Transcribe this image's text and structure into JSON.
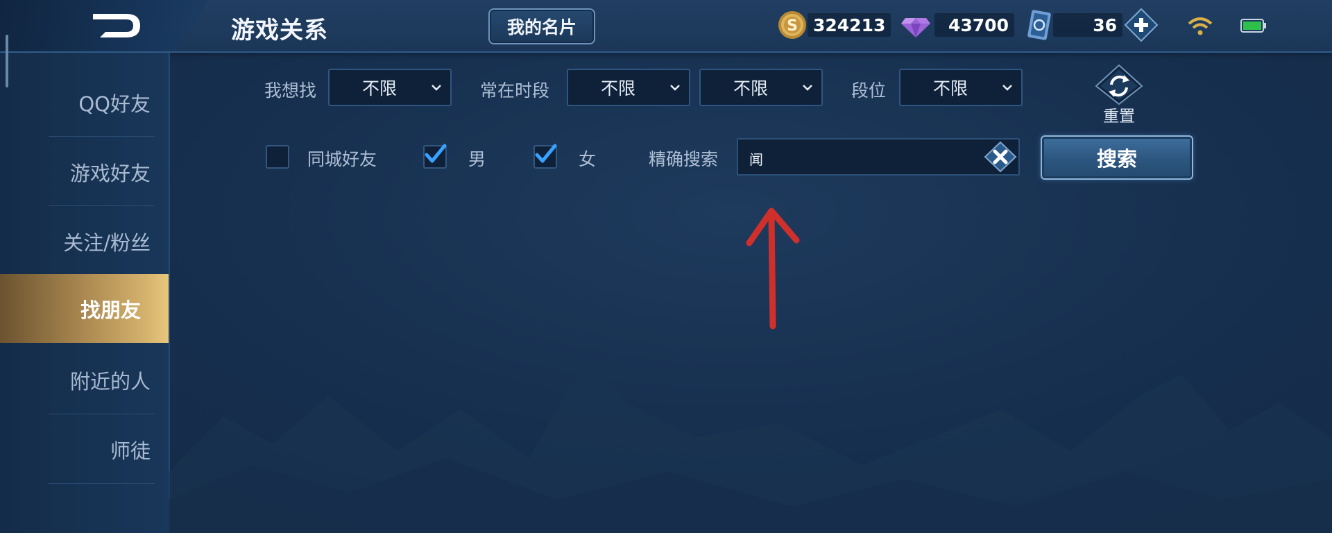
{
  "header": {
    "title": "游戏关系",
    "my_card_label": "我的名片",
    "gold": "324213",
    "diamond": "43700",
    "tickets": "36"
  },
  "sidebar": {
    "items": [
      {
        "label": "QQ好友"
      },
      {
        "label": "游戏好友"
      },
      {
        "label": "关注/粉丝"
      },
      {
        "label": "找朋友",
        "active": true
      },
      {
        "label": "附近的人"
      },
      {
        "label": "师徒"
      }
    ]
  },
  "filters": {
    "looking_for_label": "我想找",
    "looking_for_value": "不限",
    "active_time_label": "常在时段",
    "active_time_value_1": "不限",
    "active_time_value_2": "不限",
    "rank_label": "段位",
    "rank_value": "不限",
    "reset_label": "重置"
  },
  "options": {
    "same_city_label": "同城好友",
    "same_city_checked": false,
    "male_label": "男",
    "male_checked": true,
    "female_label": "女",
    "female_checked": true,
    "exact_search_label": "精确搜索",
    "search_value": "闻",
    "search_button_label": "搜索"
  },
  "colors": {
    "accent_gold": "#d3b06b",
    "check_blue": "#39a2ff",
    "annotation_red": "#d0302c"
  }
}
